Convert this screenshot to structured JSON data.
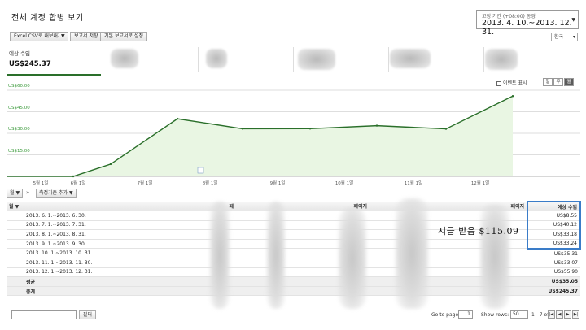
{
  "header": {
    "title": "전체 계정 합병 보기",
    "date_caption": "고정 기간 (+08:00) 동경",
    "date_range": "2013. 4. 10.~2013. 12. 31.",
    "date_arrow": "▼"
  },
  "toolbar": {
    "export_label": "Excel CSV로 내보내기",
    "export_arrow": "▼",
    "save_report_label": "보고서 저장",
    "default_report_label": "기본 보고서로 설정",
    "language": "한국"
  },
  "summary": {
    "label": "예상 수입",
    "value": "US$245.37"
  },
  "chart_controls": {
    "event_label": "이벤트 표시",
    "periods": [
      "일",
      "주",
      "월"
    ],
    "active_period": "월"
  },
  "chart_data": {
    "type": "area",
    "x": [
      "5월 1일",
      "6월 1일",
      "7월 1일",
      "8월 1일",
      "9월 1일",
      "10월 1일",
      "11월 1일",
      "12월 1일"
    ],
    "x_tick_labels": [
      "5월 1일",
      "6월 1일",
      "7월 1일",
      "8월 1일",
      "9월 1일",
      "10월 1일",
      "11월 1일",
      "12월 1일"
    ],
    "series": [
      {
        "values": [
          0,
          0,
          8.55,
          40.12,
          33.18,
          33.24,
          35.31,
          33.07,
          55.9
        ]
      }
    ],
    "series_x_months": [
      "4월 10일",
      "5월 1일",
      "6월 1일",
      "7월 1일",
      "8월 1일",
      "9월 1일",
      "10월 1일",
      "11월 1일",
      "12월 1일"
    ],
    "yticks": [
      "US$60.00",
      "US$45.00",
      "US$30.00",
      "US$15.00"
    ],
    "ylim": [
      0,
      60
    ],
    "grid": true,
    "colors": {
      "line": "#2a6f2a",
      "fill": "#e9f6e3",
      "grid": "#bdbdbd"
    }
  },
  "table_controls": {
    "dimension_select": "월",
    "dimension_arrow": "▼",
    "raquo": "»",
    "add_dimension": "측정기준 추가",
    "add_dimension_arrow": "▼"
  },
  "table": {
    "columns": [
      "월 ▼",
      "페",
      "",
      "페이지",
      "",
      "페이지",
      "예상 수입"
    ],
    "rows": [
      {
        "period": "2013. 6. 1.~2013. 6. 30.",
        "revenue": "US$8.55"
      },
      {
        "period": "2013. 7. 1.~2013. 7. 31.",
        "revenue": "US$40.12"
      },
      {
        "period": "2013. 8. 1.~2013. 8. 31.",
        "revenue": "US$33.18"
      },
      {
        "period": "2013. 9. 1.~2013. 9. 30.",
        "revenue": "US$33.24"
      },
      {
        "period": "2013. 10. 1.~2013. 10. 31.",
        "revenue": "US$35.31"
      },
      {
        "period": "2013. 11. 1.~2013. 11. 30.",
        "revenue": "US$33.07"
      },
      {
        "period": "2013. 12. 1.~2013. 12. 31.",
        "revenue": "US$55.90"
      }
    ],
    "average_label": "평균",
    "average_value": "US$35.05",
    "total_label": "총계",
    "total_value": "US$245.37"
  },
  "annotation": {
    "handwritten": "지급 받음 $115.09"
  },
  "footer": {
    "filter_button": "필터",
    "go_to_page_label": "Go to page:",
    "page_value": "1",
    "show_rows_label": "Show rows:",
    "rows_value": "50",
    "range_text": "1 - 7 of 7",
    "nav": [
      "|◀",
      "◀",
      "▶",
      "▶|"
    ]
  }
}
